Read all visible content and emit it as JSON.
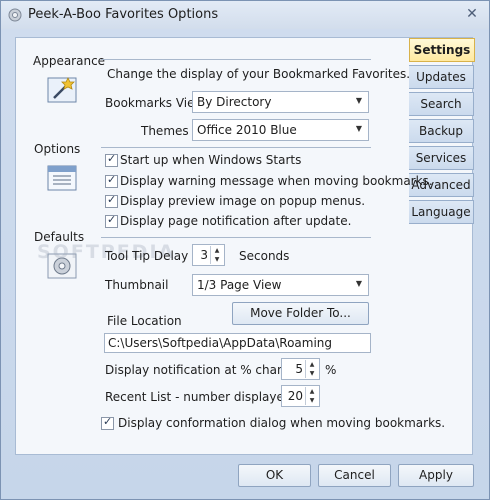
{
  "window": {
    "title": "Peek-A-Boo Favorites Options",
    "close_glyph": "✕"
  },
  "tabs": [
    {
      "label": "Settings",
      "active": true
    },
    {
      "label": "Updates"
    },
    {
      "label": "Search"
    },
    {
      "label": "Backup"
    },
    {
      "label": "Services"
    },
    {
      "label": "Advanced"
    },
    {
      "label": "Language"
    }
  ],
  "sections": {
    "appearance": {
      "label": "Appearance",
      "description": "Change the display of your Bookmarked Favorites.",
      "bookmarks_view_label": "Bookmarks View",
      "bookmarks_view_value": "By Directory",
      "themes_label": "Themes",
      "themes_value": "Office 2010 Blue"
    },
    "options": {
      "label": "Options",
      "checks": [
        {
          "label": "Start up when Windows Starts",
          "checked": true
        },
        {
          "label": "Display warning message when moving bookmarks.",
          "checked": true
        },
        {
          "label": "Display preview image on popup menus.",
          "checked": true
        },
        {
          "label": "Display page notification after update.",
          "checked": true
        }
      ]
    },
    "defaults": {
      "label": "Defaults",
      "tooltip_delay_label": "Tool Tip Delay",
      "tooltip_delay_value": "3",
      "tooltip_delay_unit": "Seconds",
      "thumbnail_label": "Thumbnail",
      "thumbnail_value": "1/3 Page View",
      "move_folder_button": "Move Folder To...",
      "file_location_label": "File Location",
      "file_location_value": "C:\\Users\\Softpedia\\AppData\\Roaming",
      "notification_label": "Display notification at % change.",
      "notification_value": "5",
      "notification_unit": "%",
      "recent_list_label": "Recent List - number displayed",
      "recent_list_value": "20",
      "confirm_check": {
        "label": "Display conformation dialog when moving bookmarks.",
        "checked": true
      }
    }
  },
  "footer": {
    "ok": "OK",
    "cancel": "Cancel",
    "apply": "Apply"
  },
  "watermark": "SOFTPEDIA"
}
